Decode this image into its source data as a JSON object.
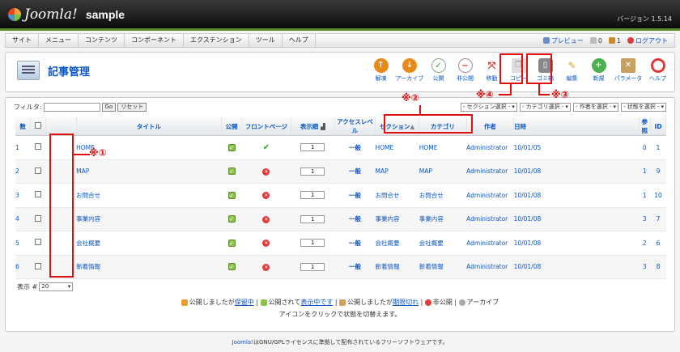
{
  "header": {
    "logo": "Joomla!",
    "site": "sample",
    "version": "バージョン 1.5.14"
  },
  "menu": {
    "items": [
      "サイト",
      "メニュー",
      "コンテンツ",
      "コンポーネント",
      "エクステンション",
      "ツール",
      "ヘルプ"
    ],
    "preview": "プレビュー",
    "count0": "0",
    "count1": "1",
    "logout": "ログアウト"
  },
  "page": {
    "title": "記事管理"
  },
  "toolbar": {
    "unarchive": "解凍",
    "archive": "アーカイブ",
    "publish": "公開",
    "unpublish": "非公開",
    "move": "移動",
    "copy": "コピー",
    "trash": "ゴミ箱",
    "edit": "編集",
    "new": "新規",
    "params": "パラメータ",
    "help": "ヘルプ"
  },
  "filter": {
    "label": "フィルタ:",
    "go": "Go",
    "reset": "リセット",
    "value": ""
  },
  "selects": [
    "- セクション選択 -",
    "- カテゴリ選択 -",
    "- 作者を選択 -",
    "- 状態を選択 -"
  ],
  "table": {
    "headers": {
      "num": "数",
      "title": "タイトル",
      "published": "公開",
      "frontpage": "フロントページ",
      "order": "表示順",
      "access": "アクセスレベル",
      "section": "セクション",
      "category": "カテゴリ",
      "author": "作者",
      "date": "日時",
      "hits": "参照",
      "id": "ID"
    },
    "rows": [
      {
        "n": "1",
        "title": "HOME",
        "order": "1",
        "access": "一般",
        "section": "HOME",
        "category": "HOME",
        "author": "Administrator",
        "date": "10/01/05",
        "hits": "0",
        "id": "1",
        "front": "check"
      },
      {
        "n": "2",
        "title": "MAP",
        "order": "1",
        "access": "一般",
        "section": "MAP",
        "category": "MAP",
        "author": "Administrator",
        "date": "10/01/08",
        "hits": "1",
        "id": "9",
        "front": "x"
      },
      {
        "n": "3",
        "title": "お問合せ",
        "order": "1",
        "access": "一般",
        "section": "お問合せ",
        "category": "お問合せ",
        "author": "Administrator",
        "date": "10/01/08",
        "hits": "1",
        "id": "10",
        "front": "x"
      },
      {
        "n": "4",
        "title": "事業内容",
        "order": "1",
        "access": "一般",
        "section": "事業内容",
        "category": "事業内容",
        "author": "Administrator",
        "date": "10/01/08",
        "hits": "3",
        "id": "7",
        "front": "x"
      },
      {
        "n": "5",
        "title": "会社概要",
        "order": "1",
        "access": "一般",
        "section": "会社概要",
        "category": "会社概要",
        "author": "Administrator",
        "date": "10/01/08",
        "hits": "2",
        "id": "6",
        "front": "x"
      },
      {
        "n": "6",
        "title": "新着情報",
        "order": "1",
        "access": "一般",
        "section": "新着情報",
        "category": "新着情報",
        "author": "Administrator",
        "date": "10/01/08",
        "hits": "3",
        "id": "8",
        "front": "x"
      }
    ]
  },
  "pager": {
    "label": "表示 #",
    "value": "20"
  },
  "legend": {
    "a": "公開しましたが",
    "a_link": "保留中",
    "b": "公開されて",
    "b_link": "表示中です",
    "c": "公開しましたが",
    "c_link": "期限切れ",
    "d": "非公開",
    "e": "アーカイブ",
    "note": "アイコンをクリックで状態を切替えます。"
  },
  "footer": {
    "link": "Joomla!",
    "text": "はGNU/GPLライセンスに準拠して配布されているフリーソフトウェアです。"
  },
  "annotations": {
    "a1": "※①",
    "a2": "※②",
    "a3": "※③",
    "a4": "※④"
  }
}
